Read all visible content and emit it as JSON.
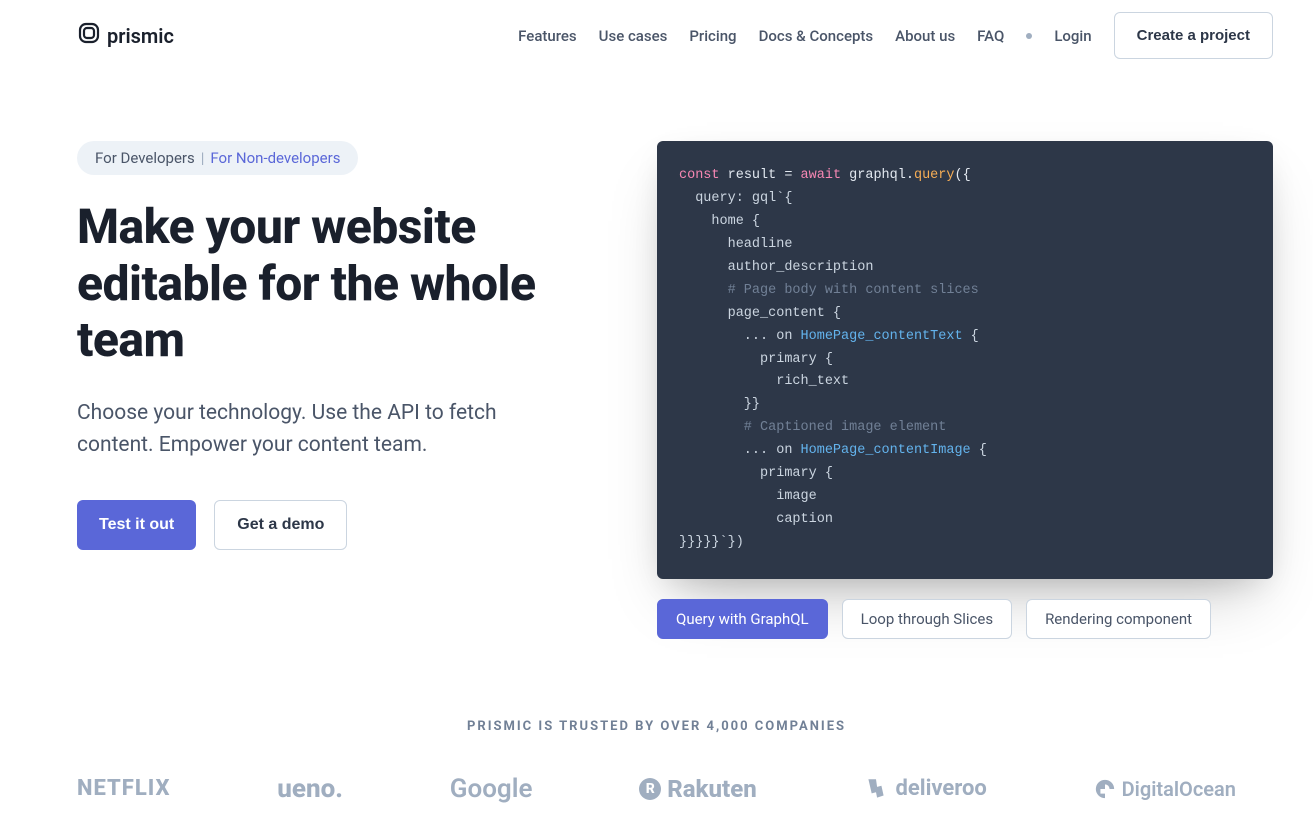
{
  "brand": "prismic",
  "nav": {
    "items": [
      "Features",
      "Use cases",
      "Pricing",
      "Docs & Concepts",
      "About us",
      "FAQ"
    ],
    "login": "Login",
    "cta": "Create a project"
  },
  "hero": {
    "pill_primary": "For Developers",
    "pill_sep": "|",
    "pill_alt": "For Non-developers",
    "headline": "Make your website editable for the whole team",
    "sub": "Choose your technology. Use the API to fetch content. Empower your content team.",
    "btn_primary": "Test it out",
    "btn_secondary": "Get a demo"
  },
  "code": {
    "l1a": "const",
    "l1b": " result ",
    "l1c": "=",
    "l1d": " await",
    "l1e": " graphql",
    "l1f": ".",
    "l1g": "query",
    "l1h": "({",
    "l2": "  query: gql`{",
    "l3": "    home {",
    "l4": "      headline",
    "l5": "      author_description",
    "l6": "      # Page body with content slices",
    "l7": "      page_content {",
    "l8a": "        ... on ",
    "l8b": "HomePage_contentText",
    "l8c": " {",
    "l9": "          primary {",
    "l10": "            rich_text",
    "l11": "        }}",
    "l12": "        # Captioned image element",
    "l13a": "        ... on ",
    "l13b": "HomePage_contentImage",
    "l13c": " {",
    "l14": "          primary {",
    "l15": "            image",
    "l16": "            caption",
    "l17": "}}}}}`})"
  },
  "code_tabs": [
    "Query with GraphQL",
    "Loop through Slices",
    "Rendering component"
  ],
  "trusted": {
    "label": "PRISMIC IS TRUSTED BY OVER 4,000 COMPANIES",
    "brands": [
      "NETFLIX",
      "ueno.",
      "Google",
      "Rakuten",
      "deliveroo",
      "DigitalOcean"
    ]
  },
  "colors": {
    "accent": "#5a67d8"
  }
}
